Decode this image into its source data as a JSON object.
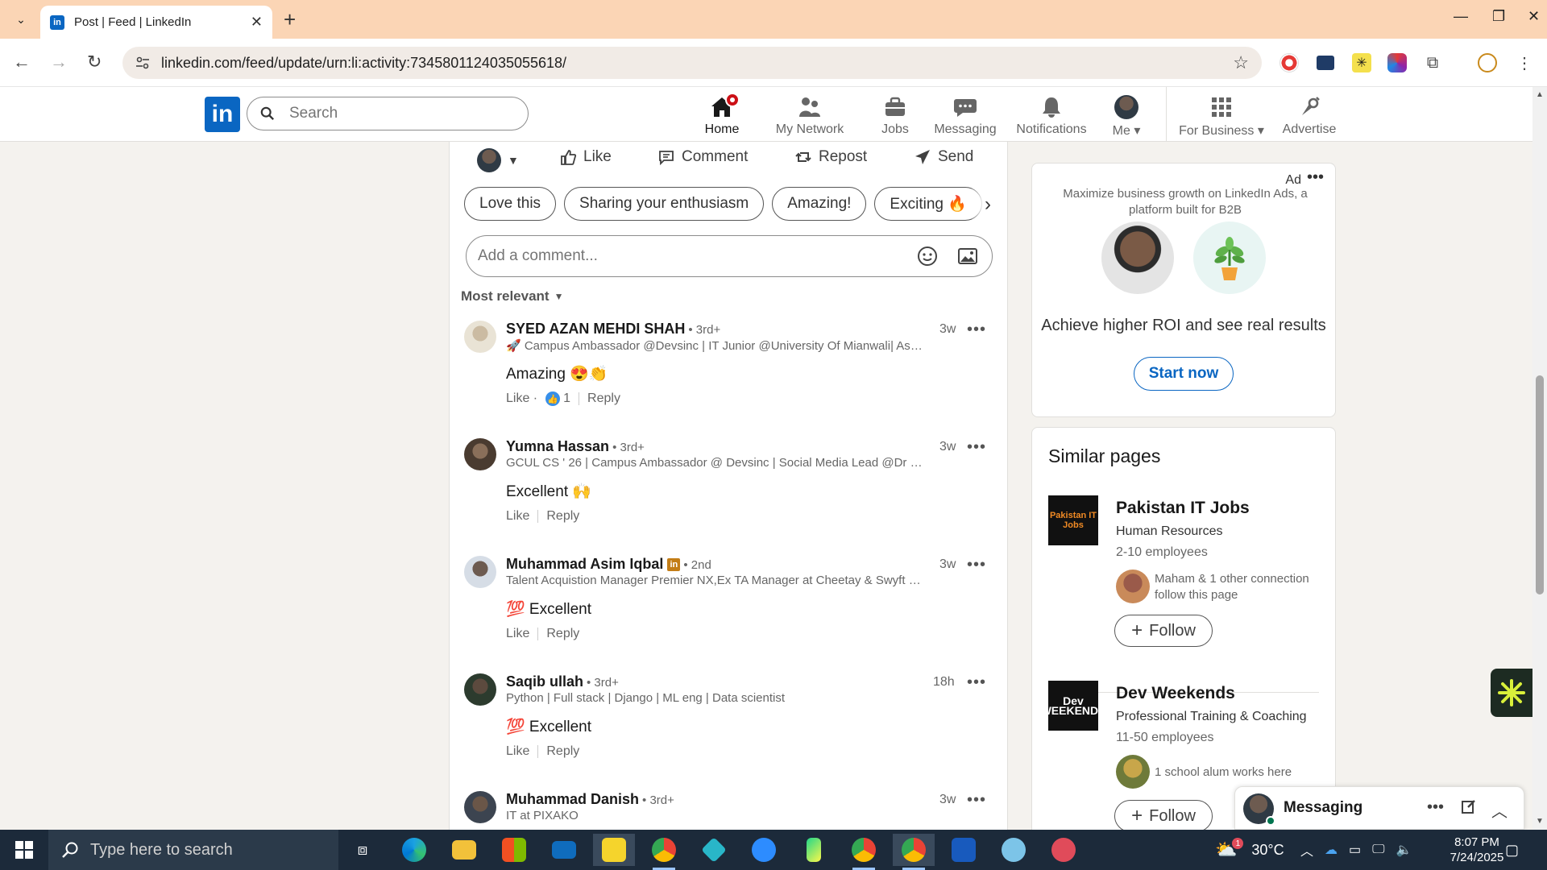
{
  "browser": {
    "tab_title": "Post | Feed | LinkedIn",
    "url": "linkedin.com/feed/update/urn:li:activity:7345801124035055618/"
  },
  "header": {
    "search_placeholder": "Search",
    "nav": [
      {
        "label": "Home",
        "icon": "home-icon"
      },
      {
        "label": "My Network",
        "icon": "network-icon"
      },
      {
        "label": "Jobs",
        "icon": "briefcase-icon"
      },
      {
        "label": "Messaging",
        "icon": "chat-icon"
      },
      {
        "label": "Notifications",
        "icon": "bell-icon"
      },
      {
        "label": "Me",
        "icon": "avatar"
      },
      {
        "label": "For Business",
        "icon": "grid-icon"
      },
      {
        "label": "Advertise",
        "icon": "megaphone-icon"
      }
    ]
  },
  "post_actions": {
    "like": "Like",
    "comment": "Comment",
    "repost": "Repost",
    "send": "Send"
  },
  "suggestions": [
    "Love this",
    "Sharing your enthusiasm",
    "Amazing!",
    "Exciting 🔥"
  ],
  "comment_box": {
    "placeholder": "Add a comment..."
  },
  "sort_label": "Most relevant",
  "comments": [
    {
      "name": "SYED AZAN MEHDI SHAH",
      "degree": "• 3rd+",
      "headline": "🚀 Campus Ambassador @Devsinc | IT Junior @University Of Mianwali| Aspi...",
      "time": "3w",
      "text": "Amazing 😍👏",
      "like": "Like ·",
      "reaction_count": "1",
      "reply": "Reply"
    },
    {
      "name": "Yumna Hassan",
      "degree": "• 3rd+",
      "headline": "GCUL CS ' 26 | Campus Ambassador @ Devsinc | Social Media Lead @Dr Cod...",
      "time": "3w",
      "text": "Excellent 🙌",
      "like": "Like",
      "reply": "Reply"
    },
    {
      "name": "Muhammad Asim Iqbal",
      "degree": "• 2nd",
      "headline": "Talent Acquistion Manager Premier NX,Ex TA Manager at Cheetay & Swyft Lo...",
      "time": "3w",
      "text": "💯 Excellent",
      "like": "Like",
      "reply": "Reply"
    },
    {
      "name": "Saqib ullah",
      "degree": "• 3rd+",
      "headline": "Python | Full stack | Django | ML eng | Data scientist",
      "time": "18h",
      "text": "💯 Excellent",
      "like": "Like",
      "reply": "Reply"
    },
    {
      "name": "Muhammad Danish",
      "degree": "• 3rd+",
      "headline": "IT at PIXAKO",
      "time": "3w"
    }
  ],
  "ad": {
    "label": "Ad",
    "subtitle": "Maximize business growth on LinkedIn Ads, a platform built for B2B",
    "headline": "Achieve higher ROI and see real results",
    "cta": "Start now"
  },
  "similar_pages": {
    "title": "Similar pages",
    "items": [
      {
        "logo_text": "Pakistan IT Jobs",
        "name": "Pakistan IT Jobs",
        "industry": "Human Resources",
        "size": "2-10 employees",
        "connections": "Maham & 1 other connection follow this page",
        "follow": "Follow"
      },
      {
        "logo_text": "Dev WEEKENDS",
        "name": "Dev Weekends",
        "industry": "Professional Training & Coaching",
        "size": "11-50 employees",
        "connections": "1 school alum works here",
        "follow": "Follow"
      }
    ]
  },
  "messaging": {
    "title": "Messaging"
  },
  "taskbar": {
    "search_placeholder": "Type here to search",
    "temperature": "30°C",
    "time": "8:07 PM",
    "date": "7/24/2025",
    "weather_badge": "1"
  },
  "colors": {
    "linkedin_blue": "#0a66c2",
    "tab_strip": "#fbd5b5",
    "taskbar": "#1c2a3a"
  }
}
